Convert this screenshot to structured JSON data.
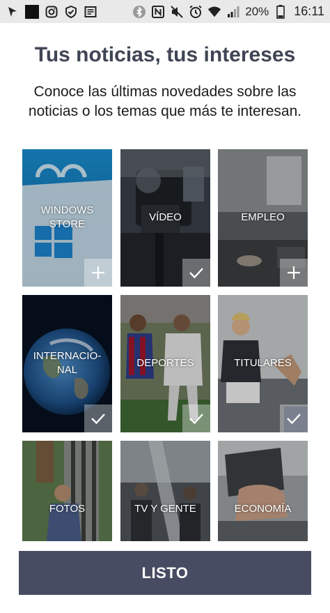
{
  "status_bar": {
    "battery_percent": "20%",
    "time": "16:11",
    "left_icons": [
      "pin-icon",
      "square-icon",
      "instagram-icon",
      "shield-icon",
      "news-icon"
    ],
    "right_icons": [
      "bluetooth-icon",
      "nfc-icon",
      "mute-icon",
      "alarm-icon",
      "wifi-icon",
      "signal-icon",
      "battery-icon"
    ]
  },
  "header": {
    "title": "Tus noticias, tus intereses",
    "subtitle": "Conoce las últimas novedades sobre las noticias o los temas que más te interesan."
  },
  "tiles": [
    {
      "label_lines": [
        "WINDOWS",
        "STORE"
      ],
      "selected": false,
      "badge_icon": "plus-icon"
    },
    {
      "label_lines": [
        "VÍDEO"
      ],
      "selected": true,
      "badge_icon": "check-icon"
    },
    {
      "label_lines": [
        "EMPLEO"
      ],
      "selected": false,
      "badge_icon": "plus-icon"
    },
    {
      "label_lines": [
        "INTERNACIO-",
        "NAL"
      ],
      "selected": true,
      "badge_icon": "check-icon"
    },
    {
      "label_lines": [
        "DEPORTES"
      ],
      "selected": true,
      "badge_icon": "check-icon"
    },
    {
      "label_lines": [
        "TITULARES"
      ],
      "selected": true,
      "badge_icon": "check-icon"
    },
    {
      "label_lines": [
        "FOTOS"
      ],
      "selected": false,
      "badge_icon": ""
    },
    {
      "label_lines": [
        "TV Y GENTE"
      ],
      "selected": false,
      "badge_icon": ""
    },
    {
      "label_lines": [
        "ECONOMÍA"
      ],
      "selected": false,
      "badge_icon": ""
    }
  ],
  "footer": {
    "done_label": "LISTO"
  },
  "colors": {
    "title": "#3f4554",
    "button": "#474c62",
    "status_bar": "#e9e9e9"
  }
}
